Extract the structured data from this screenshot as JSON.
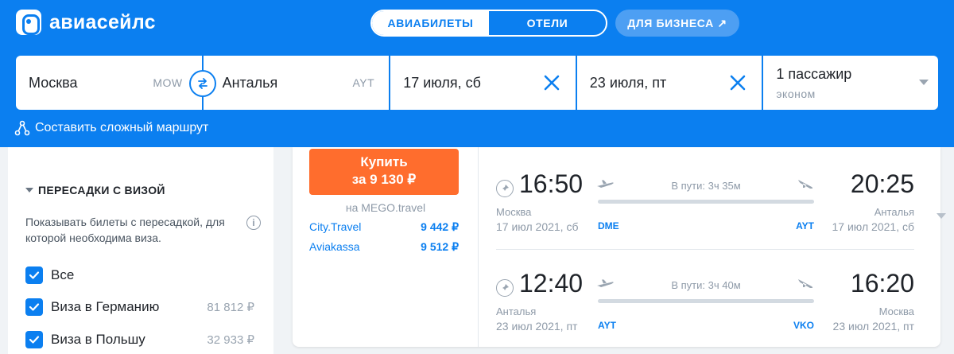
{
  "brand": {
    "name": "авиасейлс"
  },
  "nav": {
    "tabs": [
      {
        "label": "АВИАБИЛЕТЫ",
        "active": true
      },
      {
        "label": "ОТЕЛИ",
        "active": false
      }
    ],
    "business_label": "ДЛЯ БИЗНЕСА ↗"
  },
  "search": {
    "origin": {
      "value": "Москва",
      "code": "MOW"
    },
    "destination": {
      "value": "Анталья",
      "code": "AYT"
    },
    "date_depart": "17 июля, сб",
    "date_return": "23 июля, пт",
    "passengers": "1 пассажир",
    "cabin_class": "эконом",
    "complex_route_label": "Составить сложный маршрут"
  },
  "filters": {
    "title": "ПЕРЕСАДКИ С ВИЗОЙ",
    "description": "Показывать билеты с пересадкой, для которой необходима виза.",
    "options": [
      {
        "label": "Все",
        "checked": true,
        "price": ""
      },
      {
        "label": "Виза в Германию",
        "checked": true,
        "price": "81 812 ₽"
      },
      {
        "label": "Виза в Польшу",
        "checked": true,
        "price": "32 933 ₽"
      }
    ]
  },
  "ticket": {
    "buy_line1": "Купить",
    "buy_line2": "за 9 130 ₽",
    "agency": "на MEGO.travel",
    "offers": [
      {
        "name": "City.Travel",
        "price": "9 442 ₽"
      },
      {
        "name": "Aviakassa",
        "price": "9 512 ₽"
      }
    ],
    "segments": [
      {
        "dep_time": "16:50",
        "arr_time": "20:25",
        "dep_city": "Москва",
        "arr_city": "Анталья",
        "dep_date": "17 июл 2021, сб",
        "arr_date": "17 июл 2021, сб",
        "duration": "В пути: 3ч 35м",
        "dep_code": "DME",
        "arr_code": "AYT"
      },
      {
        "dep_time": "12:40",
        "arr_time": "16:20",
        "dep_city": "Анталья",
        "arr_city": "Москва",
        "dep_date": "23 июл 2021, пт",
        "arr_date": "23 июл 2021, пт",
        "duration": "В пути: 3ч 40м",
        "dep_code": "AYT",
        "arr_code": "VKO"
      }
    ]
  },
  "colors": {
    "brand_blue": "#0b7ff0",
    "buy_orange": "#ff6d2d"
  },
  "icons": [
    "logo-icon",
    "swap-icon",
    "close-icon",
    "chevron-down-icon",
    "route-icon",
    "info-icon",
    "checkmark-icon",
    "pin-icon",
    "takeoff-icon",
    "landing-icon"
  ]
}
